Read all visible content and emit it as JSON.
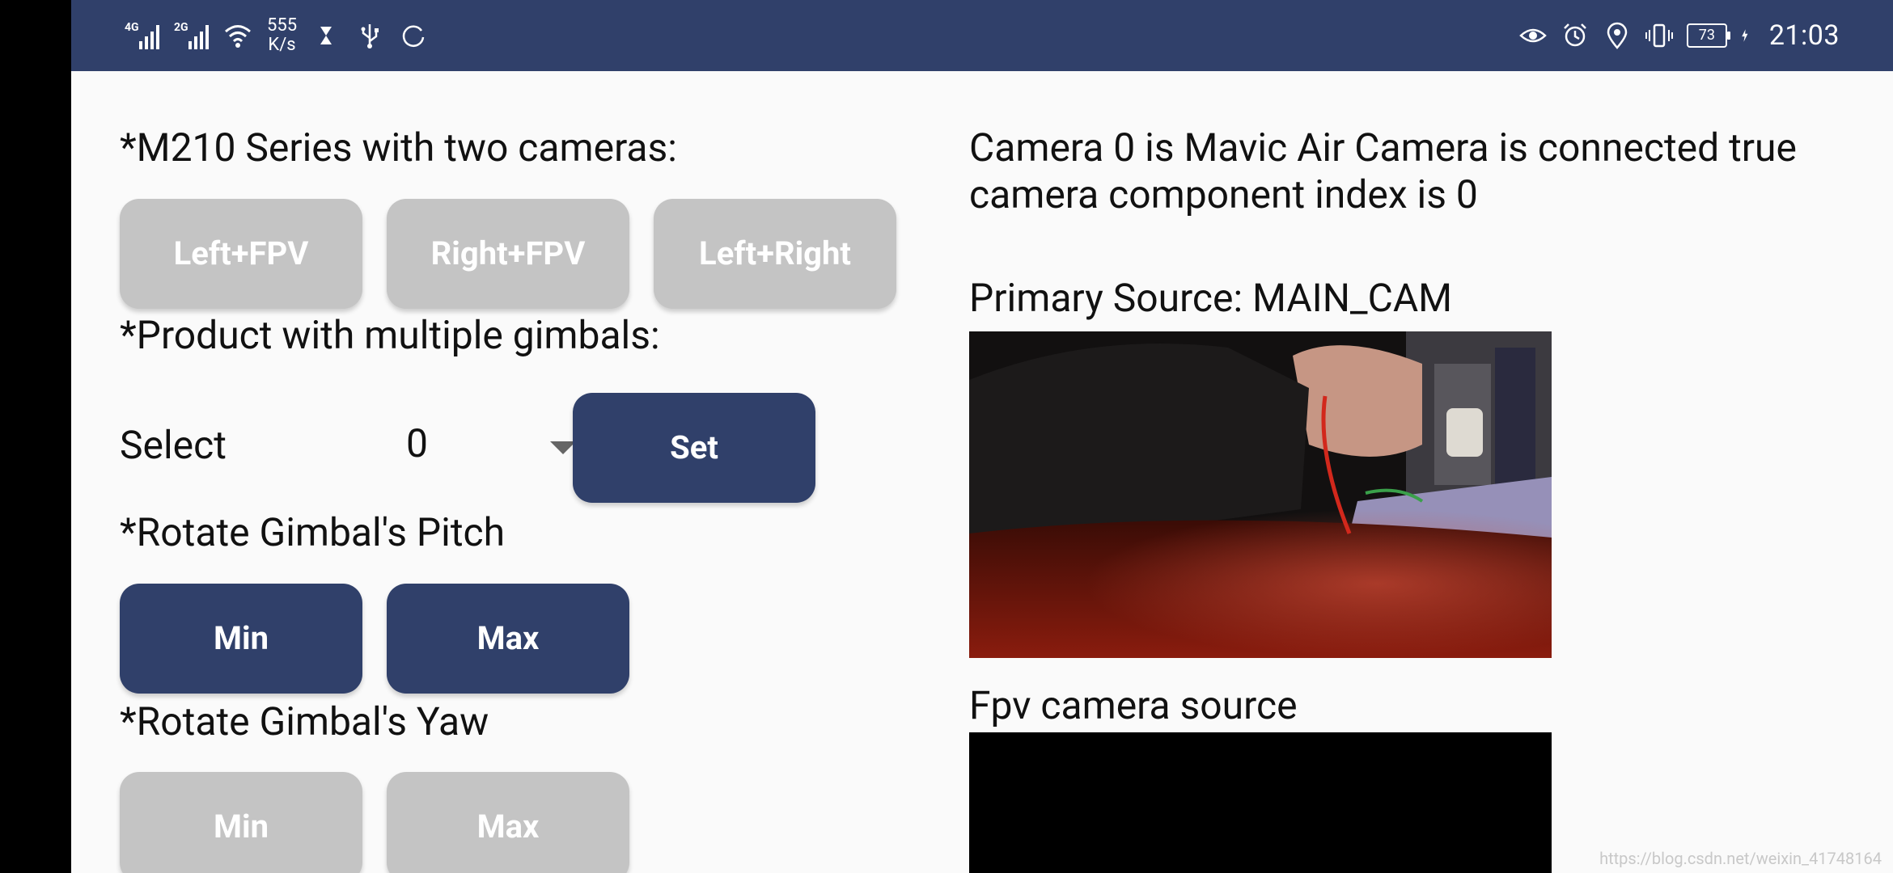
{
  "statusbar": {
    "network_1": "4G",
    "network_2": "2G",
    "speed_value": "555",
    "speed_unit": "K/s",
    "battery_level": "73",
    "time": "21:03"
  },
  "left": {
    "m210_title": "*M210 Series with two cameras:",
    "m210_buttons": [
      "Left+FPV",
      "Right+FPV",
      "Left+Right"
    ],
    "gimbals_title": "*Product with multiple gimbals:",
    "select_label": "Select",
    "select_value": "0",
    "set_label": "Set",
    "pitch_title": "*Rotate Gimbal's Pitch",
    "pitch_min": "Min",
    "pitch_max": "Max",
    "yaw_title": "*Rotate Gimbal's Yaw",
    "yaw_min": "Min",
    "yaw_max": "Max"
  },
  "right": {
    "camera_status_line1": "Camera 0 is Mavic Air Camera is connected true",
    "camera_status_line2": "camera component index is 0",
    "primary_source": "Primary Source: MAIN_CAM",
    "fpv_source": "Fpv camera source"
  },
  "watermark": "https://blog.csdn.net/weixin_41748164",
  "colors": {
    "accent": "#30406a",
    "disabled_button": "#c4c4c4",
    "background": "#fafafa"
  }
}
